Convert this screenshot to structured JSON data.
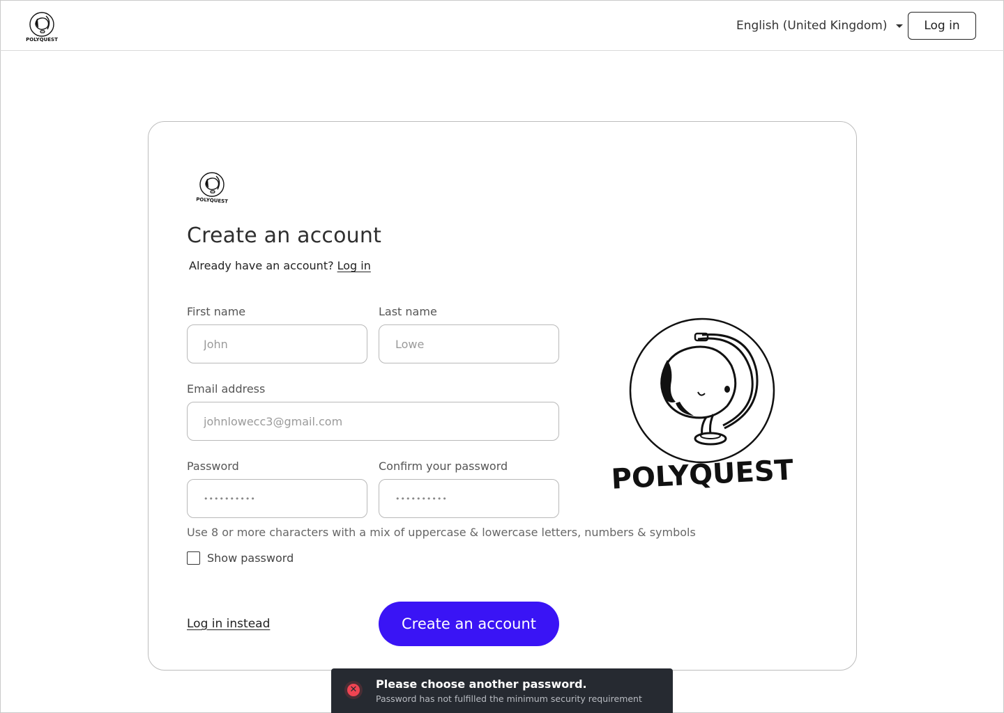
{
  "brand": {
    "name": "POLYQUEST"
  },
  "header": {
    "language": "English (United Kingdom)",
    "login_label": "Log in"
  },
  "form": {
    "title": "Create an account",
    "have_account_text": "Already have an account?",
    "have_account_link": "Log in",
    "first_name": {
      "label": "First name",
      "placeholder": "John"
    },
    "last_name": {
      "label": "Last name",
      "placeholder": "Lowe"
    },
    "email": {
      "label": "Email address",
      "placeholder": "johnlowecc3@gmail.com"
    },
    "password": {
      "label": "Password",
      "value": "••••••••••"
    },
    "confirm_password": {
      "label": "Confirm your password",
      "value": "••••••••••"
    },
    "hint": "Use 8 or more characters with a mix of uppercase & lowercase letters, numbers & symbols",
    "show_password_label": "Show password",
    "show_password_checked": false,
    "login_instead_label": "Log in instead",
    "submit_label": "Create an account"
  },
  "toast": {
    "icon": "error-icon",
    "title": "Please choose another password.",
    "message": "Password has not fulfilled the minimum security requirement"
  },
  "colors": {
    "primary": "#3a14f5",
    "toast_bg": "#262a31",
    "error": "#f04452"
  }
}
